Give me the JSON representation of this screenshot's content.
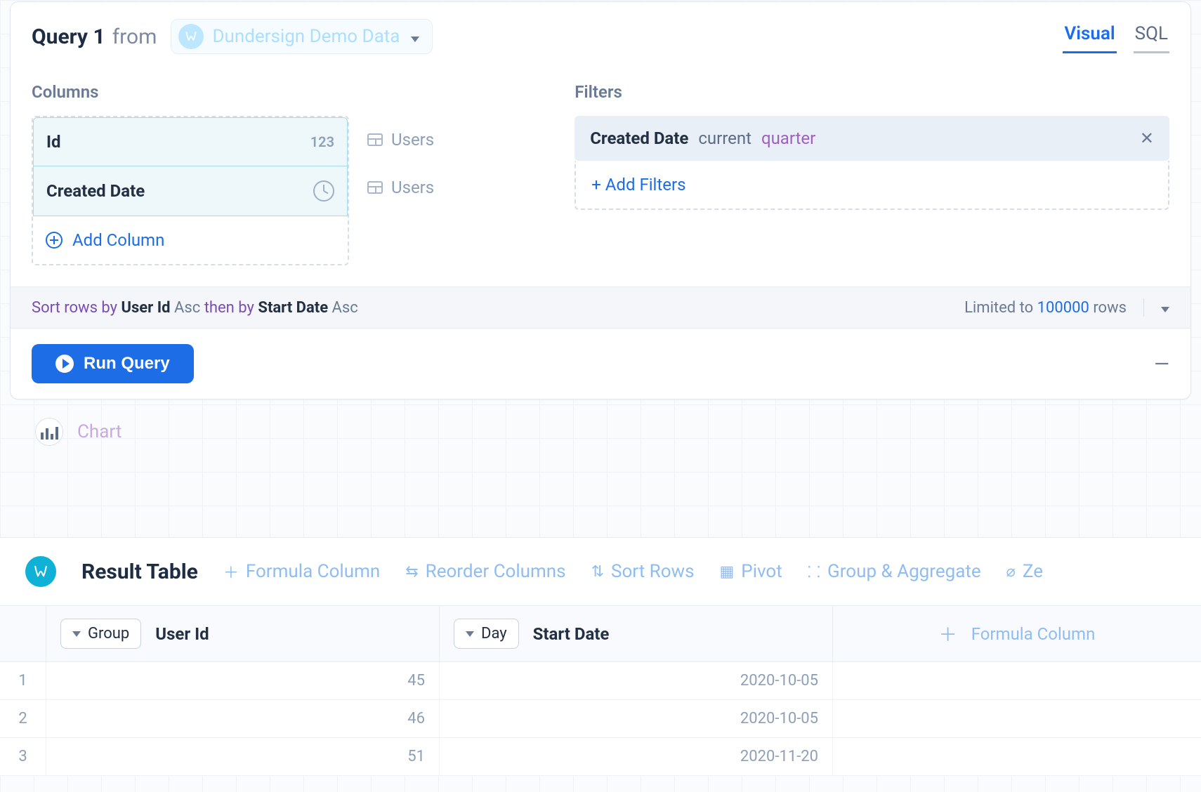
{
  "query": {
    "title": "Query 1",
    "from_label": "from",
    "datasource": "Dundersign Demo Data",
    "tabs": {
      "visual": "Visual",
      "sql": "SQL"
    }
  },
  "columns": {
    "section_label": "Columns",
    "items": [
      {
        "name": "Id",
        "badge": "123",
        "source": "Users"
      },
      {
        "name": "Created Date",
        "badge_icon": "clock",
        "source": "Users"
      }
    ],
    "add_label": "Add Column"
  },
  "filters": {
    "section_label": "Filters",
    "applied": {
      "field": "Created Date",
      "op": "current",
      "value": "quarter"
    },
    "add_label": "+ Add Filters"
  },
  "sort_bar": {
    "prefix": "Sort rows by",
    "field1": "User Id",
    "dir1": "Asc",
    "then": "then by",
    "field2": "Start Date",
    "dir2": "Asc",
    "limit_prefix": "Limited to",
    "limit_value": "100000",
    "limit_suffix": "rows"
  },
  "run": {
    "label": "Run Query"
  },
  "chart_stub": {
    "label": "Chart"
  },
  "result": {
    "title": "Result Table",
    "actions": {
      "formula": "Formula Column",
      "reorder": "Reorder Columns",
      "sort": "Sort Rows",
      "pivot": "Pivot",
      "group": "Group & Aggregate",
      "ze": "Ze"
    },
    "col1": {
      "pill": "Group",
      "title": "User Id"
    },
    "col2": {
      "pill": "Day",
      "title": "Start Date"
    },
    "col3": {
      "formula": "Formula Column"
    },
    "rows": [
      {
        "idx": "1",
        "user_id": "45",
        "start_date": "2020-10-05"
      },
      {
        "idx": "2",
        "user_id": "46",
        "start_date": "2020-10-05"
      },
      {
        "idx": "3",
        "user_id": "51",
        "start_date": "2020-11-20"
      }
    ]
  }
}
